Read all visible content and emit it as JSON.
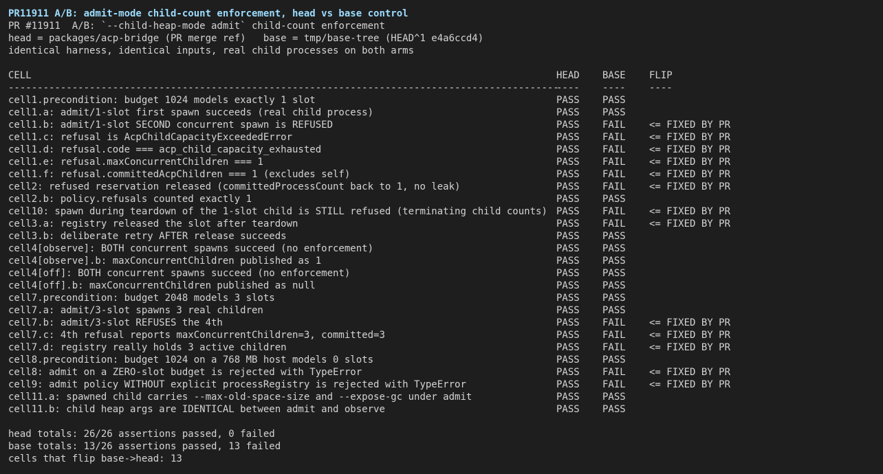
{
  "header": {
    "title": "PR11911 A/B: admit-mode child-count enforcement, head vs base control",
    "line2": "PR #11911  A/B: `--child-heap-mode admit` child-count enforcement",
    "line3": "head = packages/acp-bridge (PR merge ref)   base = tmp/base-tree (HEAD^1 e4a6ccd4)",
    "line4": "identical harness, identical inputs, real child processes on both arms"
  },
  "table": {
    "columns": {
      "cell": "CELL",
      "head": "HEAD",
      "base": "BASE",
      "flip": "FLIP"
    },
    "separators": {
      "cell": "-----------------------------------------------------------------------------------------------",
      "head": "----",
      "base": "----",
      "flip": "----"
    },
    "rows": [
      {
        "cell": "cell1.precondition: budget 1024 models exactly 1 slot",
        "head": "PASS",
        "base": "PASS",
        "flip": ""
      },
      {
        "cell": "cell1.a: admit/1-slot first spawn succeeds (real child process)",
        "head": "PASS",
        "base": "PASS",
        "flip": ""
      },
      {
        "cell": "cell1.b: admit/1-slot SECOND concurrent spawn is REFUSED",
        "head": "PASS",
        "base": "FAIL",
        "flip": "<= FIXED BY PR"
      },
      {
        "cell": "cell1.c: refusal is AcpChildCapacityExceededError",
        "head": "PASS",
        "base": "FAIL",
        "flip": "<= FIXED BY PR"
      },
      {
        "cell": "cell1.d: refusal.code === acp_child_capacity_exhausted",
        "head": "PASS",
        "base": "FAIL",
        "flip": "<= FIXED BY PR"
      },
      {
        "cell": "cell1.e: refusal.maxConcurrentChildren === 1",
        "head": "PASS",
        "base": "FAIL",
        "flip": "<= FIXED BY PR"
      },
      {
        "cell": "cell1.f: refusal.committedAcpChildren === 1 (excludes self)",
        "head": "PASS",
        "base": "FAIL",
        "flip": "<= FIXED BY PR"
      },
      {
        "cell": "cell2: refused reservation released (committedProcessCount back to 1, no leak)",
        "head": "PASS",
        "base": "FAIL",
        "flip": "<= FIXED BY PR"
      },
      {
        "cell": "cell2.b: policy.refusals counted exactly 1",
        "head": "PASS",
        "base": "PASS",
        "flip": ""
      },
      {
        "cell": "cell10: spawn during teardown of the 1-slot child is STILL refused (terminating child counts)",
        "head": "PASS",
        "base": "FAIL",
        "flip": "<= FIXED BY PR"
      },
      {
        "cell": "cell3.a: registry released the slot after teardown",
        "head": "PASS",
        "base": "FAIL",
        "flip": "<= FIXED BY PR"
      },
      {
        "cell": "cell3.b: deliberate retry AFTER release succeeds",
        "head": "PASS",
        "base": "PASS",
        "flip": ""
      },
      {
        "cell": "cell4[observe]: BOTH concurrent spawns succeed (no enforcement)",
        "head": "PASS",
        "base": "PASS",
        "flip": ""
      },
      {
        "cell": "cell4[observe].b: maxConcurrentChildren published as 1",
        "head": "PASS",
        "base": "PASS",
        "flip": ""
      },
      {
        "cell": "cell4[off]: BOTH concurrent spawns succeed (no enforcement)",
        "head": "PASS",
        "base": "PASS",
        "flip": ""
      },
      {
        "cell": "cell4[off].b: maxConcurrentChildren published as null",
        "head": "PASS",
        "base": "PASS",
        "flip": ""
      },
      {
        "cell": "cell7.precondition: budget 2048 models 3 slots",
        "head": "PASS",
        "base": "PASS",
        "flip": ""
      },
      {
        "cell": "cell7.a: admit/3-slot spawns 3 real children",
        "head": "PASS",
        "base": "PASS",
        "flip": ""
      },
      {
        "cell": "cell7.b: admit/3-slot REFUSES the 4th",
        "head": "PASS",
        "base": "FAIL",
        "flip": "<= FIXED BY PR"
      },
      {
        "cell": "cell7.c: 4th refusal reports maxConcurrentChildren=3, committed=3",
        "head": "PASS",
        "base": "FAIL",
        "flip": "<= FIXED BY PR"
      },
      {
        "cell": "cell7.d: registry really holds 3 active children",
        "head": "PASS",
        "base": "FAIL",
        "flip": "<= FIXED BY PR"
      },
      {
        "cell": "cell8.precondition: budget 1024 on a 768 MB host models 0 slots",
        "head": "PASS",
        "base": "PASS",
        "flip": ""
      },
      {
        "cell": "cell8: admit on a ZERO-slot budget is rejected with TypeError",
        "head": "PASS",
        "base": "FAIL",
        "flip": "<= FIXED BY PR"
      },
      {
        "cell": "cell9: admit policy WITHOUT explicit processRegistry is rejected with TypeError",
        "head": "PASS",
        "base": "FAIL",
        "flip": "<= FIXED BY PR"
      },
      {
        "cell": "cell11.a: spawned child carries --max-old-space-size and --expose-gc under admit",
        "head": "PASS",
        "base": "PASS",
        "flip": ""
      },
      {
        "cell": "cell11.b: child heap args are IDENTICAL between admit and observe",
        "head": "PASS",
        "base": "PASS",
        "flip": ""
      }
    ]
  },
  "totals": {
    "head": "head totals: 26/26 assertions passed, 0 failed",
    "base": "base totals: 13/26 assertions passed, 13 failed",
    "flips": "cells that flip base->head: 13"
  },
  "colors": {
    "background": "#1e1e1e",
    "text": "#d4d4d4",
    "title": "#9cdcfe"
  }
}
